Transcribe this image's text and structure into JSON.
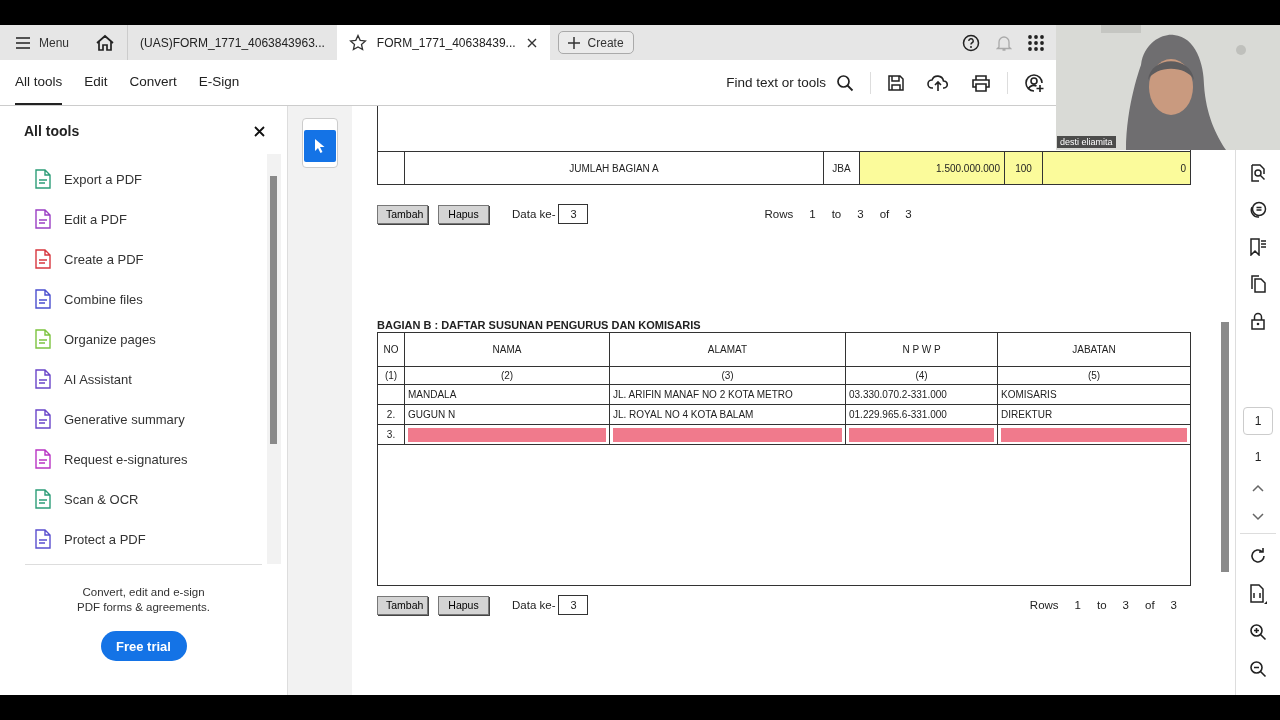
{
  "browser_bar": {
    "menu_label": "Menu",
    "tabs": [
      {
        "label": "(UAS)FORM_1771_4063843963...",
        "selected": false,
        "starred": false
      },
      {
        "label": "FORM_1771_40638439...",
        "selected": true,
        "starred": true
      }
    ],
    "create_label": "Create"
  },
  "toolbar": {
    "tabs": [
      {
        "label": "All tools",
        "selected": true
      },
      {
        "label": "Edit",
        "selected": false
      },
      {
        "label": "Convert",
        "selected": false
      },
      {
        "label": "E-Sign",
        "selected": false
      }
    ],
    "find_label": "Find text or tools"
  },
  "tools_panel": {
    "title": "All tools",
    "items": [
      {
        "label": "Export a PDF"
      },
      {
        "label": "Edit a PDF"
      },
      {
        "label": "Create a PDF"
      },
      {
        "label": "Combine files"
      },
      {
        "label": "Organize pages"
      },
      {
        "label": "AI Assistant"
      },
      {
        "label": "Generative summary"
      },
      {
        "label": "Request e-signatures"
      },
      {
        "label": "Scan & OCR"
      },
      {
        "label": "Protect a PDF"
      }
    ],
    "promo_lines": [
      "Convert, edit and e-sign",
      "PDF forms & agreements."
    ],
    "trial_button": "Free trial"
  },
  "video": {
    "kind": "picture",
    "name": "desti eliamita"
  },
  "section_a": {
    "total_row": {
      "label": "JUMLAH BAGIAN A",
      "code": "JBA",
      "amount": "1.500.000.000",
      "percent": "100",
      "column_5": "0"
    },
    "buttons": [
      "Tambah",
      "Hapus"
    ],
    "data_label": "Data ke-",
    "data_value": "3",
    "pagination": [
      "Rows",
      "1",
      "to",
      "3",
      "of",
      "3"
    ]
  },
  "section_b": {
    "title": "BAGIAN B : DAFTAR SUSUNAN PENGURUS DAN KOMISARIS",
    "columns": [
      "NO",
      "NAMA",
      "ALAMAT",
      "N P W P",
      "JABATAN"
    ],
    "column_numbers": [
      "(1)",
      "(2)",
      "(3)",
      "(4)",
      "(5)"
    ],
    "rows": [
      {
        "kind": "text",
        "cells": [
          "",
          "MANDALA",
          "JL. ARIFIN MANAF NO 2 KOTA METRO",
          "03.330.070.2-331.000",
          "KOMISARIS"
        ]
      },
      {
        "kind": "text",
        "cells": [
          "2.",
          "GUGUN N",
          "JL. ROYAL NO 4 KOTA BALAM",
          "01.229.965.6-331.000",
          "DIREKTUR"
        ]
      },
      {
        "kind": "input",
        "cells": [
          "3."
        ]
      }
    ],
    "buttons": [
      "Tambah",
      "Hapus"
    ],
    "data_label": "Data ke-",
    "data_value": "3",
    "pagination": [
      "Rows",
      "1",
      "to",
      "3",
      "of",
      "3"
    ]
  },
  "right_rail": {
    "page_value": "1",
    "page_total": "1"
  }
}
